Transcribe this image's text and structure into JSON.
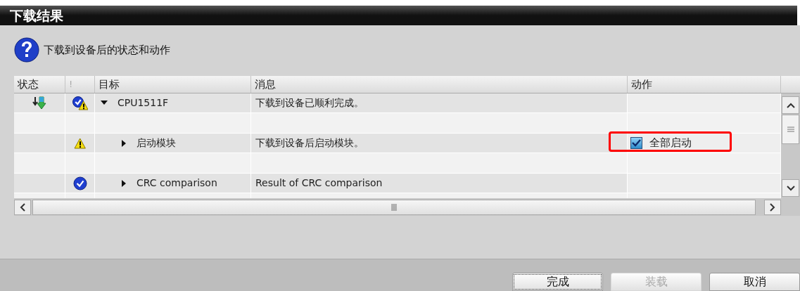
{
  "window": {
    "title": "下载结果"
  },
  "header": {
    "text": "下载到设备后的状态和动作"
  },
  "table": {
    "columns": [
      "状态",
      "!",
      "目标",
      "消息",
      "动作"
    ],
    "rows": [
      {
        "status": {
          "kind": "download"
        },
        "severity": {
          "kind": "ok_warning"
        },
        "target": "CPU1511F",
        "expanded": true,
        "message": "下载到设备已顺利完成。"
      },
      {
        "severity": {
          "kind": "warning"
        },
        "target": "启动模块",
        "expanded": false,
        "message": "下载到设备后启动模块。",
        "action": {
          "label": "全部启动",
          "checked": true,
          "highlighted": true
        }
      },
      {
        "severity": {
          "kind": "ok"
        },
        "target": "CRC comparison",
        "expanded": false,
        "message": "Result of CRC comparison"
      }
    ]
  },
  "buttons": [
    {
      "label": "完成",
      "focused": true,
      "disabled": false
    },
    {
      "label": "装载",
      "focused": false,
      "disabled": true
    },
    {
      "label": "取消",
      "focused": false,
      "disabled": false
    }
  ]
}
